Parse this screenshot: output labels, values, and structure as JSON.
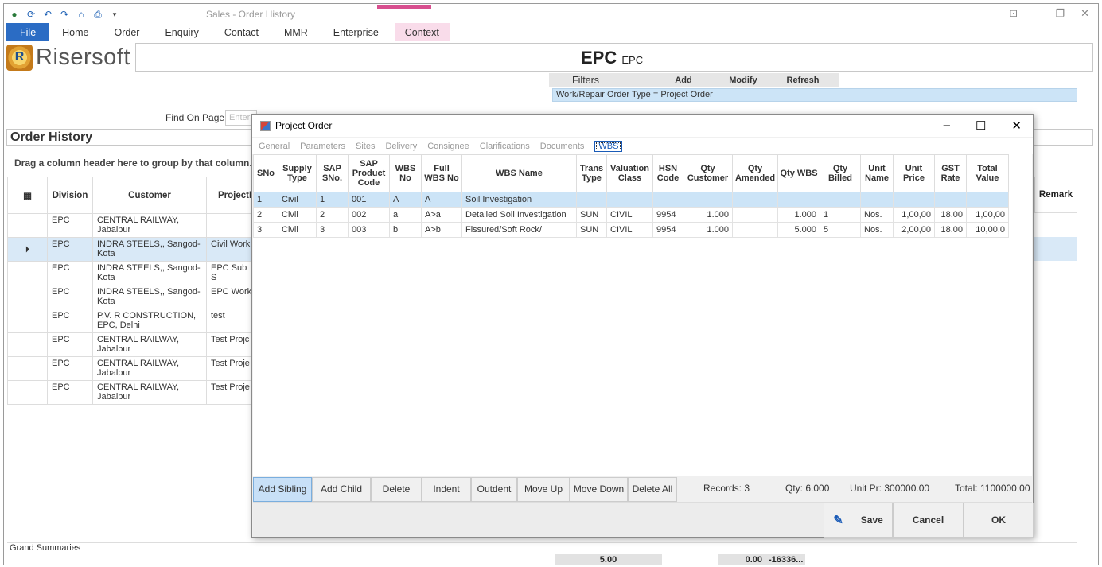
{
  "app": {
    "title": "Sales - Order History"
  },
  "menu": [
    "File",
    "Home",
    "Order",
    "Enquiry",
    "Contact",
    "MMR",
    "Enterprise",
    "Context"
  ],
  "logo": {
    "mark": "R",
    "text": "Risersoft"
  },
  "header": {
    "main": "EPC",
    "sub": "EPC"
  },
  "filters": {
    "label": "Filters",
    "add": "Add",
    "modify": "Modify",
    "refresh": "Refresh",
    "condition": "Work/Repair Order Type = Project Order"
  },
  "find": {
    "label": "Find On Page",
    "placeholder": "Enter"
  },
  "order_history": {
    "title": "Order History",
    "group_hint": "Drag a column header here to group by that column.",
    "columns": [
      "Division",
      "Customer",
      "ProjectN",
      "Remark"
    ],
    "rows": [
      {
        "division": "EPC",
        "customer": "CENTRAL RAILWAY, Jabalpur",
        "project": ""
      },
      {
        "division": "EPC",
        "customer": "INDRA STEELS,, Sangod-Kota",
        "project": "Civil Work"
      },
      {
        "division": "EPC",
        "customer": "INDRA STEELS,, Sangod-Kota",
        "project": "EPC Sub S"
      },
      {
        "division": "EPC",
        "customer": "INDRA STEELS,, Sangod-Kota",
        "project": "EPC Work"
      },
      {
        "division": "EPC",
        "customer": "P.V. R CONSTRUCTION, EPC, Delhi",
        "project": "test"
      },
      {
        "division": "EPC",
        "customer": "CENTRAL RAILWAY, Jabalpur",
        "project": "Test Projc"
      },
      {
        "division": "EPC",
        "customer": "CENTRAL RAILWAY, Jabalpur",
        "project": "Test Proje"
      },
      {
        "division": "EPC",
        "customer": "CENTRAL RAILWAY, Jabalpur",
        "project": "Test Proje"
      }
    ],
    "grand_summaries": {
      "label": "Grand Summaries",
      "v1": "5.00",
      "v2": "0.00",
      "v3": "-16336..."
    }
  },
  "dialog": {
    "title": "Project Order",
    "tabs": [
      "General",
      "Parameters",
      "Sites",
      "Delivery",
      "Consignee",
      "Clarifications",
      "Documents",
      "WBS"
    ],
    "columns": [
      "SNo",
      "Supply Type",
      "SAP SNo.",
      "SAP Product Code",
      "WBS No",
      "Full WBS No",
      "WBS Name",
      "Trans Type",
      "Valuation Class",
      "HSN Code",
      "Qty Customer",
      "Qty Amended",
      "Qty WBS",
      "Qty Billed",
      "Unit Name",
      "Unit Price",
      "GST Rate",
      "Total Value"
    ],
    "rows": [
      [
        "1",
        "Civil",
        "1",
        "001",
        "A",
        "A",
        "Soil Investigation",
        "",
        "",
        "",
        "",
        "",
        "",
        "",
        "",
        "",
        "",
        ""
      ],
      [
        "2",
        "Civil",
        "2",
        "002",
        "a",
        "A>a",
        "Detailed Soil Investigation",
        "SUN",
        "CIVIL",
        "9954",
        "1.000",
        "",
        "1.000",
        "1",
        "Nos.",
        "1,00,00",
        "18.00",
        "1,00,00"
      ],
      [
        "3",
        "Civil",
        "3",
        "003",
        "b",
        "A>b",
        "Fissured/Soft Rock/",
        "SUN",
        "CIVIL",
        "9954",
        "1.000",
        "",
        "5.000",
        "5",
        "Nos.",
        "2,00,00",
        "18.00",
        "10,00,0"
      ]
    ],
    "buttons": [
      "Add Sibling",
      "Add Child",
      "Delete",
      "Indent",
      "Outdent",
      "Move Up",
      "Move Down",
      "Delete All"
    ],
    "status": {
      "records": "Records: 3",
      "qty": "Qty: 6.000",
      "unit_pr": "Unit Pr: 300000.00",
      "total": "Total: 1100000.00"
    },
    "actions": {
      "save": "Save",
      "cancel": "Cancel",
      "ok": "OK"
    }
  }
}
